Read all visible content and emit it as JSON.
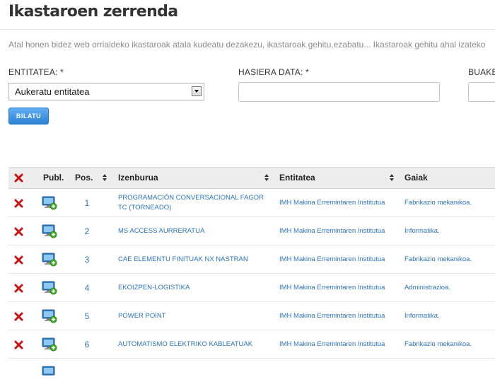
{
  "page": {
    "title": "Ikastaroen zerrenda",
    "description": "Atal honen bidez web orrialdeko ikastaroak atala kudeatu dezakezu, ikastaroak gehitu,ezabatu... Ikastaroak gehitu ahal izateko"
  },
  "filters": {
    "entity_label": "ENTITATEA: *",
    "entity_selected": "Aukeratu entitatea",
    "start_label": "HASIERA DATA: *",
    "end_label": "BUAKE",
    "search_button": "BILATU"
  },
  "table": {
    "headers": {
      "publish": "Publ.",
      "position": "Pos.",
      "title": "Izenburua",
      "entity": "Entitatea",
      "topics": "Gaiak"
    },
    "rows": [
      {
        "pos": "1",
        "title_line1": "PROGRAMACIÓN CONVERSACIONAL FAGOR",
        "title_line2": "TC (TORNEADO)",
        "entity": "IMH Makina Erremintaren Institutua",
        "topic": "Fabrikazio mekanikoa."
      },
      {
        "pos": "2",
        "title_line1": "MS ACCESS AURRERATUA",
        "title_line2": "",
        "entity": "IMH Makina Erremintaren Institutua",
        "topic": "Informatika."
      },
      {
        "pos": "3",
        "title_line1": "CAE ELEMENTU FINITUAK NX NASTRAN",
        "title_line2": "",
        "entity": "IMH Makina Erremintaren Institutua",
        "topic": "Fabrikazio mekanikoa."
      },
      {
        "pos": "4",
        "title_line1": "EKOIZPEN-LOGISTIKA",
        "title_line2": "",
        "entity": "IMH Makina Erremintaren Institutua",
        "topic": "Administrazioa."
      },
      {
        "pos": "5",
        "title_line1": "POWER POINT",
        "title_line2": "",
        "entity": "IMH Makina Erremintaren Institutua",
        "topic": "Informatika."
      },
      {
        "pos": "6",
        "title_line1": "AUTOMATISMO ELEKTRIKO KABLEATUAK",
        "title_line2": "",
        "entity": "IMH Makina Erremintaren Institutua",
        "topic": "Fabrikazio mekanikoa."
      }
    ]
  },
  "colors": {
    "accent": "#2c82d4",
    "link": "#2a74b8",
    "delete": "#cc1111",
    "publish_badge": "#3fae2a"
  },
  "icons": {
    "delete": "red-x-icon",
    "publish": "monitor-add-icon",
    "sort": "sort-arrows-icon"
  }
}
